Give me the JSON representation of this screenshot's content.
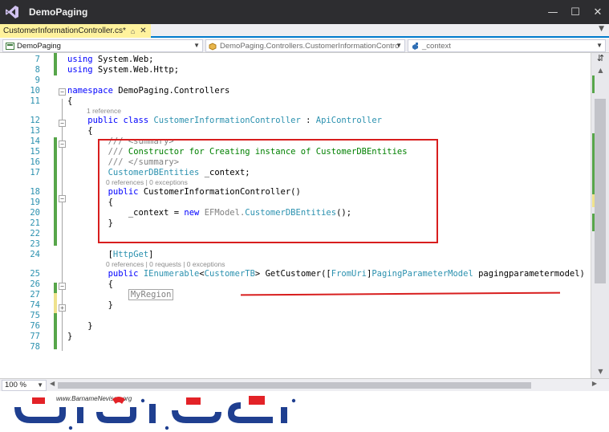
{
  "window": {
    "title": "DemoPaging",
    "buttons": [
      "—",
      "☐",
      "✕"
    ]
  },
  "tab": {
    "label": "CustomerInformationController.cs*",
    "pin": "⌂",
    "close": "✕"
  },
  "navbar": {
    "project": "DemoPaging",
    "type": "DemoPaging.Controllers.CustomerInformationContro",
    "member": "_context"
  },
  "editor": {
    "zoom": "100 %",
    "lines": [
      {
        "num": "7",
        "tokens": [
          {
            "t": "using",
            "c": "kw"
          },
          {
            "t": " System.Web;",
            "c": "pl"
          }
        ]
      },
      {
        "num": "8",
        "tokens": [
          {
            "t": "using",
            "c": "kw"
          },
          {
            "t": " System.Web.Http;",
            "c": "pl"
          }
        ]
      },
      {
        "num": "9",
        "tokens": []
      },
      {
        "num": "10",
        "tokens": [
          {
            "t": "namespace",
            "c": "kw"
          },
          {
            "t": " DemoPaging.Controllers",
            "c": "pl"
          }
        ]
      },
      {
        "num": "11",
        "tokens": [
          {
            "t": "{",
            "c": "pl"
          }
        ]
      },
      {
        "lens": "1 reference",
        "indent": 24
      },
      {
        "num": "12",
        "tokens": [
          {
            "t": "    public",
            "c": "kw"
          },
          {
            "t": " class",
            "c": "kw"
          },
          {
            "t": " CustomerInformationController",
            "c": "ty"
          },
          {
            "t": " : ",
            "c": "pl"
          },
          {
            "t": "ApiController",
            "c": "ty"
          }
        ]
      },
      {
        "num": "13",
        "tokens": [
          {
            "t": "    {",
            "c": "pl"
          }
        ]
      },
      {
        "num": "14",
        "tokens": [
          {
            "t": "        /// ",
            "c": "xd"
          },
          {
            "t": "<summary>",
            "c": "xd"
          }
        ]
      },
      {
        "num": "15",
        "tokens": [
          {
            "t": "        ///",
            "c": "xd"
          },
          {
            "t": " Constructor for Creating instance of CustomerDBEntities",
            "c": "cm"
          }
        ]
      },
      {
        "num": "16",
        "tokens": [
          {
            "t": "        /// ",
            "c": "xd"
          },
          {
            "t": "</summary>",
            "c": "xd"
          }
        ]
      },
      {
        "num": "17",
        "tokens": [
          {
            "t": "        CustomerDBEntities",
            "c": "ty"
          },
          {
            "t": " _context;",
            "c": "pl"
          }
        ]
      },
      {
        "lens": "0 references | 0 exceptions",
        "indent": 48
      },
      {
        "num": "18",
        "tokens": [
          {
            "t": "        public",
            "c": "kw"
          },
          {
            "t": " CustomerInformationController()",
            "c": "pl"
          }
        ]
      },
      {
        "num": "19",
        "tokens": [
          {
            "t": "        {",
            "c": "pl"
          }
        ]
      },
      {
        "num": "20",
        "tokens": [
          {
            "t": "            _context = ",
            "c": "pl"
          },
          {
            "t": "new",
            "c": "kw"
          },
          {
            "t": " EFModel.",
            "c": "xd"
          },
          {
            "t": "CustomerDBEntities",
            "c": "ty"
          },
          {
            "t": "();",
            "c": "pl"
          }
        ]
      },
      {
        "num": "21",
        "tokens": [
          {
            "t": "        }",
            "c": "pl"
          }
        ]
      },
      {
        "num": "22",
        "tokens": []
      },
      {
        "num": "23",
        "tokens": []
      },
      {
        "num": "24",
        "tokens": [
          {
            "t": "        [",
            "c": "pl"
          },
          {
            "t": "HttpGet",
            "c": "ty"
          },
          {
            "t": "]",
            "c": "pl"
          }
        ]
      },
      {
        "lens": "0 references | 0 requests | 0 exceptions",
        "indent": 48
      },
      {
        "num": "25",
        "tokens": [
          {
            "t": "        public",
            "c": "kw"
          },
          {
            "t": " IEnumerable",
            "c": "ty"
          },
          {
            "t": "<",
            "c": "pl"
          },
          {
            "t": "CustomerTB",
            "c": "ty"
          },
          {
            "t": "> GetCustomer([",
            "c": "pl"
          },
          {
            "t": "FromUri",
            "c": "ty"
          },
          {
            "t": "]",
            "c": "pl"
          },
          {
            "t": "PagingParameterModel",
            "c": "ty"
          },
          {
            "t": " pagingparametermodel)",
            "c": "pl"
          }
        ]
      },
      {
        "num": "26",
        "tokens": [
          {
            "t": "        {",
            "c": "pl"
          }
        ]
      },
      {
        "num": "27",
        "region": "MyRegion"
      },
      {
        "num": "74",
        "tokens": [
          {
            "t": "        }",
            "c": "pl"
          }
        ]
      },
      {
        "num": "75",
        "tokens": []
      },
      {
        "num": "76",
        "tokens": [
          {
            "t": "    }",
            "c": "pl"
          }
        ]
      },
      {
        "num": "77",
        "tokens": [
          {
            "t": "}",
            "c": "pl"
          }
        ]
      },
      {
        "num": "78",
        "tokens": []
      }
    ]
  },
  "watermark": {
    "url": "www.BarnameNevisan.org"
  }
}
